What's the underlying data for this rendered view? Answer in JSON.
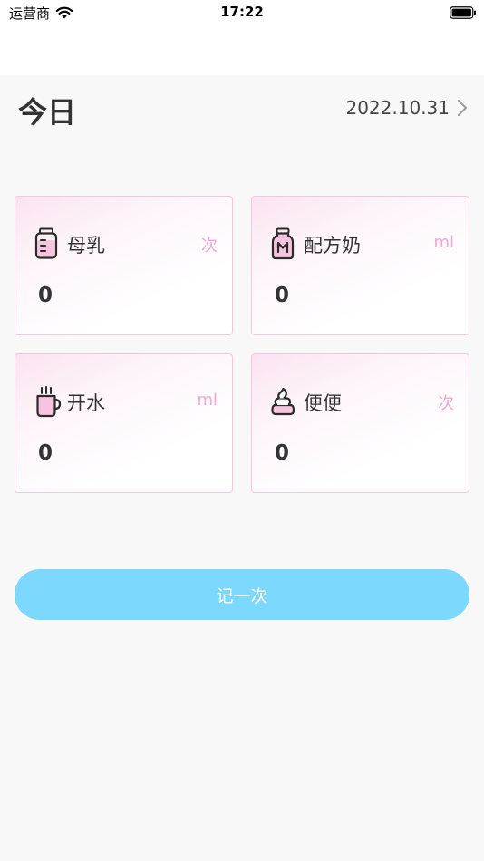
{
  "status_bar": {
    "carrier": "运营商",
    "time": "17:22"
  },
  "header": {
    "title": "今日",
    "date": "2022.10.31"
  },
  "cards": [
    {
      "label": "母乳",
      "unit": "次",
      "value": "0",
      "icon": "baby-bottle-icon"
    },
    {
      "label": "配方奶",
      "unit": "ml",
      "value": "0",
      "icon": "formula-milk-icon"
    },
    {
      "label": "开水",
      "unit": "ml",
      "value": "0",
      "icon": "water-cup-icon"
    },
    {
      "label": "便便",
      "unit": "次",
      "value": "0",
      "icon": "poop-icon"
    }
  ],
  "actions": {
    "record_label": "记一次"
  },
  "colors": {
    "accent_pink": "#f0a7d2",
    "button_blue": "#7dd8fd",
    "background": "#f8f8f8"
  }
}
